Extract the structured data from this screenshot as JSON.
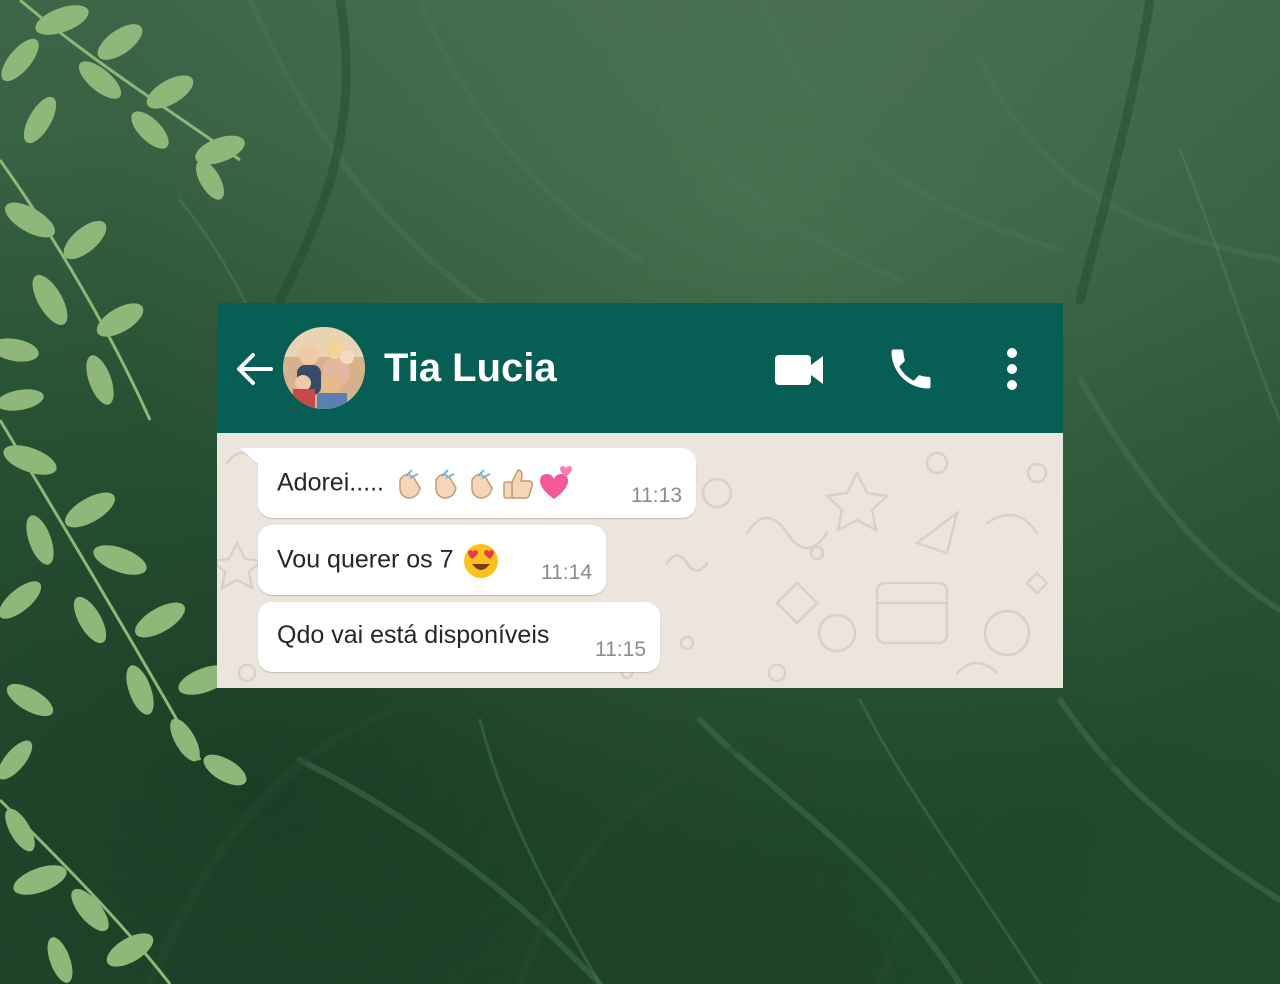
{
  "header": {
    "contact_name": "Tia Lucia",
    "back_icon": "arrow-left-icon",
    "avatar": "contact-avatar-photo",
    "video_icon": "video-camera-icon",
    "call_icon": "phone-icon",
    "menu_icon": "more-vertical-icon"
  },
  "messages": [
    {
      "text": "Adorei.....",
      "emojis": [
        "clapping-hands",
        "clapping-hands",
        "clapping-hands",
        "thumbs-up",
        "two-hearts"
      ],
      "time": "11:13"
    },
    {
      "text": "Vou querer os 7",
      "emojis": [
        "heart-eyes-face"
      ],
      "time": "11:14"
    },
    {
      "text": "Qdo vai está disponíveis",
      "emojis": [],
      "time": "11:15"
    }
  ],
  "colors": {
    "header": "#075e54",
    "chat_background": "#ece5dd",
    "bubble": "#ffffff",
    "page_background": "#2f5a3b",
    "leaves": "#8fb77a"
  }
}
